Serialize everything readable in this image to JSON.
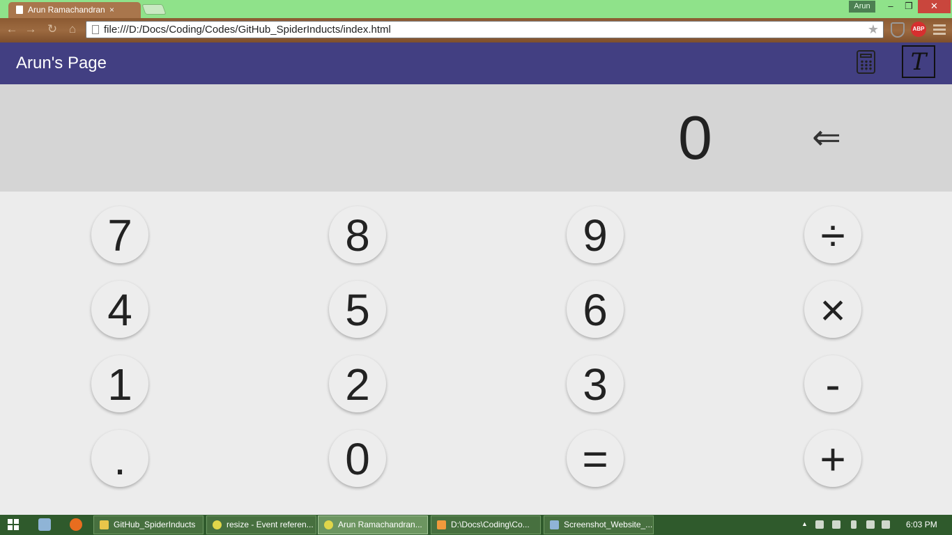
{
  "browser": {
    "tab_title": "Arun Ramachandran",
    "tab_close": "×",
    "user_name": "Arun",
    "url": "file:///D:/Docs/Coding/Codes/GitHub_SpiderInducts/index.html",
    "extensions": [
      "shield-extension-icon",
      "abp-icon"
    ],
    "abp_label": "ABP",
    "window_controls": [
      "–",
      "❐",
      "✕"
    ]
  },
  "app": {
    "title": "Arun's Page",
    "header_color": "#423f82",
    "icons": [
      "calculator-icon",
      "text-editor-icon"
    ],
    "text_icon_glyph": "T"
  },
  "calculator": {
    "display_value": "0",
    "backspace_glyph": "⇐",
    "keys": [
      [
        "7",
        "8",
        "9",
        "÷"
      ],
      [
        "4",
        "5",
        "6",
        "×"
      ],
      [
        "1",
        "2",
        "3",
        "-"
      ],
      [
        ".",
        "0",
        "=",
        "+"
      ]
    ]
  },
  "taskbar": {
    "items": [
      {
        "label": "GitHub_SpiderInducts",
        "icon": "folder-icon",
        "color": "#e8c64a",
        "active": false
      },
      {
        "label": "resize - Event referen...",
        "icon": "chrome-icon",
        "color": "#e0d64a",
        "active": false
      },
      {
        "label": "Arun Ramachandran...",
        "icon": "chrome-icon",
        "color": "#e0d64a",
        "active": true
      },
      {
        "label": "D:\\Docs\\Coding\\Co...",
        "icon": "sublime-icon",
        "color": "#f09a3c",
        "active": false
      },
      {
        "label": "Screenshot_Website_...",
        "icon": "window-icon",
        "color": "#8fb4d6",
        "active": false
      }
    ],
    "clock": "6:03 PM"
  }
}
